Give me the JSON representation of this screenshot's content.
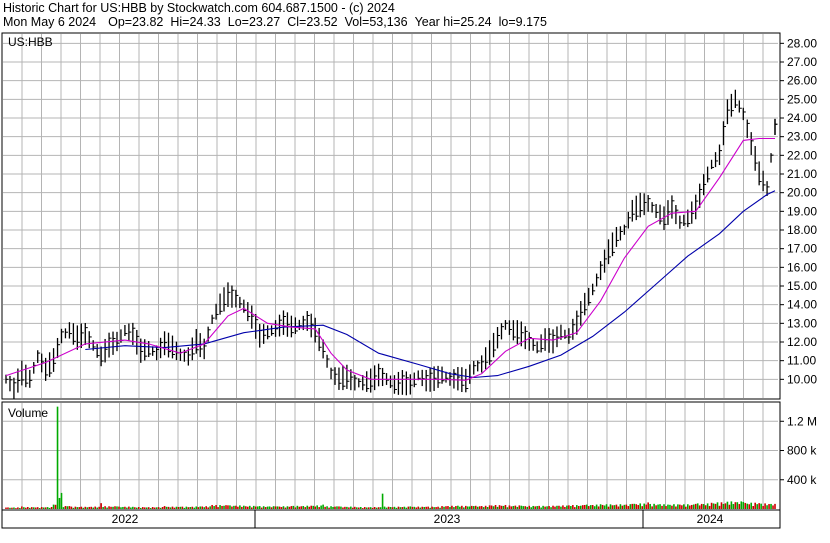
{
  "header": {
    "title": "Historic Chart for US:HBB by Stockwatch.com 604.687.1500 - (c) 2024",
    "date": "Mon May  6 2024",
    "op": "Op=23.82",
    "hi": "Hi=24.33",
    "lo": "Lo=23.27",
    "cl": "Cl=23.52",
    "vol": "Vol=53,136",
    "year_hi": "Year hi=25.24",
    "year_lo": "lo=9.175"
  },
  "colors": {
    "price_bars": "#000000",
    "ma_short": "#cc00cc",
    "ma_long": "#0000aa",
    "volume_up": "#00aa00",
    "volume_down": "#cc0000",
    "grid": "#b4b4b4"
  },
  "chart_data": [
    {
      "type": "line",
      "title": "US:HBB",
      "price_ylim": [
        9.0,
        28.5
      ],
      "y_ticks": [
        "28.00",
        "27.00",
        "26.00",
        "25.00",
        "24.00",
        "23.00",
        "22.00",
        "21.00",
        "20.00",
        "19.00",
        "18.00",
        "17.00",
        "16.00",
        "15.00",
        "14.00",
        "13.00",
        "12.00",
        "11.00",
        "10.00"
      ],
      "x_labels": [
        "2022",
        "2023",
        "2024"
      ],
      "grid": true,
      "price_series": [
        {
          "x": 0,
          "y": 10.0
        },
        {
          "x": 2,
          "y": 9.5
        },
        {
          "x": 4,
          "y": 10.3
        },
        {
          "x": 6,
          "y": 10.0
        },
        {
          "x": 8,
          "y": 11.2
        },
        {
          "x": 10,
          "y": 10.5
        },
        {
          "x": 12,
          "y": 11.0
        },
        {
          "x": 14,
          "y": 12.3
        },
        {
          "x": 16,
          "y": 12.6
        },
        {
          "x": 18,
          "y": 12.2
        },
        {
          "x": 20,
          "y": 12.4
        },
        {
          "x": 22,
          "y": 11.8
        },
        {
          "x": 24,
          "y": 11.2
        },
        {
          "x": 26,
          "y": 11.8
        },
        {
          "x": 28,
          "y": 12.0
        },
        {
          "x": 30,
          "y": 12.6
        },
        {
          "x": 32,
          "y": 12.4
        },
        {
          "x": 34,
          "y": 11.5
        },
        {
          "x": 36,
          "y": 11.6
        },
        {
          "x": 38,
          "y": 11.4
        },
        {
          "x": 40,
          "y": 11.9
        },
        {
          "x": 42,
          "y": 11.7
        },
        {
          "x": 44,
          "y": 11.3
        },
        {
          "x": 46,
          "y": 11.2
        },
        {
          "x": 48,
          "y": 12.0
        },
        {
          "x": 50,
          "y": 11.6
        },
        {
          "x": 52,
          "y": 13.2
        },
        {
          "x": 54,
          "y": 14.0
        },
        {
          "x": 56,
          "y": 14.5
        },
        {
          "x": 58,
          "y": 14.3
        },
        {
          "x": 60,
          "y": 13.9
        },
        {
          "x": 62,
          "y": 13.3
        },
        {
          "x": 64,
          "y": 12.3
        },
        {
          "x": 66,
          "y": 12.5
        },
        {
          "x": 68,
          "y": 12.7
        },
        {
          "x": 70,
          "y": 13.0
        },
        {
          "x": 72,
          "y": 12.8
        },
        {
          "x": 74,
          "y": 12.9
        },
        {
          "x": 76,
          "y": 13.1
        },
        {
          "x": 78,
          "y": 12.6
        },
        {
          "x": 80,
          "y": 11.6
        },
        {
          "x": 82,
          "y": 10.3
        },
        {
          "x": 84,
          "y": 10.0
        },
        {
          "x": 86,
          "y": 10.1
        },
        {
          "x": 88,
          "y": 9.8
        },
        {
          "x": 90,
          "y": 9.8
        },
        {
          "x": 92,
          "y": 9.9
        },
        {
          "x": 94,
          "y": 10.2
        },
        {
          "x": 96,
          "y": 10.0
        },
        {
          "x": 98,
          "y": 9.7
        },
        {
          "x": 100,
          "y": 9.8
        },
        {
          "x": 102,
          "y": 9.7
        },
        {
          "x": 104,
          "y": 10.2
        },
        {
          "x": 106,
          "y": 9.9
        },
        {
          "x": 108,
          "y": 10.0
        },
        {
          "x": 110,
          "y": 10.2
        },
        {
          "x": 112,
          "y": 10.0
        },
        {
          "x": 114,
          "y": 10.0
        },
        {
          "x": 116,
          "y": 9.9
        },
        {
          "x": 118,
          "y": 10.6
        },
        {
          "x": 120,
          "y": 10.8
        },
        {
          "x": 122,
          "y": 11.4
        },
        {
          "x": 124,
          "y": 12.2
        },
        {
          "x": 126,
          "y": 12.9
        },
        {
          "x": 128,
          "y": 12.6
        },
        {
          "x": 130,
          "y": 12.4
        },
        {
          "x": 132,
          "y": 12.0
        },
        {
          "x": 134,
          "y": 11.7
        },
        {
          "x": 136,
          "y": 12.1
        },
        {
          "x": 138,
          "y": 12.0
        },
        {
          "x": 140,
          "y": 12.5
        },
        {
          "x": 142,
          "y": 12.3
        },
        {
          "x": 144,
          "y": 13.0
        },
        {
          "x": 146,
          "y": 14.0
        },
        {
          "x": 148,
          "y": 14.8
        },
        {
          "x": 150,
          "y": 15.8
        },
        {
          "x": 152,
          "y": 16.8
        },
        {
          "x": 154,
          "y": 17.6
        },
        {
          "x": 156,
          "y": 18.0
        },
        {
          "x": 158,
          "y": 19.0
        },
        {
          "x": 160,
          "y": 19.3
        },
        {
          "x": 162,
          "y": 19.4
        },
        {
          "x": 164,
          "y": 19.0
        },
        {
          "x": 166,
          "y": 18.6
        },
        {
          "x": 168,
          "y": 19.2
        },
        {
          "x": 170,
          "y": 18.4
        },
        {
          "x": 172,
          "y": 18.6
        },
        {
          "x": 174,
          "y": 19.2
        },
        {
          "x": 176,
          "y": 20.4
        },
        {
          "x": 178,
          "y": 21.5
        },
        {
          "x": 180,
          "y": 22.0
        },
        {
          "x": 182,
          "y": 24.3
        },
        {
          "x": 184,
          "y": 25.0
        },
        {
          "x": 186,
          "y": 24.2
        },
        {
          "x": 188,
          "y": 22.6
        },
        {
          "x": 190,
          "y": 21.0
        },
        {
          "x": 192,
          "y": 20.2
        },
        {
          "x": 194,
          "y": 23.5
        }
      ],
      "ma_short": [
        {
          "x": 0,
          "y": 10.2
        },
        {
          "x": 10,
          "y": 10.9
        },
        {
          "x": 20,
          "y": 11.9
        },
        {
          "x": 30,
          "y": 12.1
        },
        {
          "x": 36,
          "y": 11.9
        },
        {
          "x": 44,
          "y": 11.4
        },
        {
          "x": 50,
          "y": 11.9
        },
        {
          "x": 56,
          "y": 13.4
        },
        {
          "x": 60,
          "y": 13.8
        },
        {
          "x": 66,
          "y": 13.0
        },
        {
          "x": 72,
          "y": 12.8
        },
        {
          "x": 78,
          "y": 12.7
        },
        {
          "x": 82,
          "y": 11.4
        },
        {
          "x": 86,
          "y": 10.5
        },
        {
          "x": 92,
          "y": 10.0
        },
        {
          "x": 100,
          "y": 10.0
        },
        {
          "x": 110,
          "y": 10.0
        },
        {
          "x": 116,
          "y": 9.95
        },
        {
          "x": 120,
          "y": 10.3
        },
        {
          "x": 126,
          "y": 11.5
        },
        {
          "x": 132,
          "y": 12.2
        },
        {
          "x": 138,
          "y": 12.1
        },
        {
          "x": 144,
          "y": 12.5
        },
        {
          "x": 150,
          "y": 14.2
        },
        {
          "x": 156,
          "y": 16.5
        },
        {
          "x": 162,
          "y": 18.2
        },
        {
          "x": 168,
          "y": 18.9
        },
        {
          "x": 174,
          "y": 19.0
        },
        {
          "x": 180,
          "y": 20.8
        },
        {
          "x": 186,
          "y": 22.8
        },
        {
          "x": 190,
          "y": 22.9
        },
        {
          "x": 194,
          "y": 22.9
        }
      ],
      "ma_long": [
        {
          "x": 20,
          "y": 11.6
        },
        {
          "x": 30,
          "y": 11.8
        },
        {
          "x": 40,
          "y": 11.7
        },
        {
          "x": 50,
          "y": 11.9
        },
        {
          "x": 60,
          "y": 12.5
        },
        {
          "x": 70,
          "y": 12.8
        },
        {
          "x": 80,
          "y": 12.9
        },
        {
          "x": 86,
          "y": 12.4
        },
        {
          "x": 94,
          "y": 11.4
        },
        {
          "x": 104,
          "y": 10.8
        },
        {
          "x": 112,
          "y": 10.3
        },
        {
          "x": 118,
          "y": 10.1
        },
        {
          "x": 124,
          "y": 10.2
        },
        {
          "x": 132,
          "y": 10.7
        },
        {
          "x": 140,
          "y": 11.3
        },
        {
          "x": 148,
          "y": 12.3
        },
        {
          "x": 156,
          "y": 13.6
        },
        {
          "x": 164,
          "y": 15.1
        },
        {
          "x": 172,
          "y": 16.6
        },
        {
          "x": 180,
          "y": 17.8
        },
        {
          "x": 186,
          "y": 19.0
        },
        {
          "x": 192,
          "y": 19.9
        },
        {
          "x": 194,
          "y": 20.1
        }
      ]
    },
    {
      "type": "bar",
      "title": "Volume",
      "y_ticks": [
        "1.2 M",
        "800 k",
        "400 k"
      ],
      "ylim": [
        0,
        1450000
      ],
      "volume_series": [
        {
          "x": 0,
          "y": 20000
        },
        {
          "x": 4,
          "y": 35000
        },
        {
          "x": 8,
          "y": 25000
        },
        {
          "x": 12,
          "y": 60000
        },
        {
          "x": 13,
          "y": 1400000
        },
        {
          "x": 14,
          "y": 220000
        },
        {
          "x": 16,
          "y": 40000
        },
        {
          "x": 20,
          "y": 30000
        },
        {
          "x": 24,
          "y": 80000
        },
        {
          "x": 28,
          "y": 35000
        },
        {
          "x": 32,
          "y": 30000
        },
        {
          "x": 36,
          "y": 25000
        },
        {
          "x": 40,
          "y": 40000
        },
        {
          "x": 44,
          "y": 30000
        },
        {
          "x": 48,
          "y": 35000
        },
        {
          "x": 52,
          "y": 55000
        },
        {
          "x": 56,
          "y": 50000
        },
        {
          "x": 60,
          "y": 45000
        },
        {
          "x": 64,
          "y": 40000
        },
        {
          "x": 68,
          "y": 35000
        },
        {
          "x": 72,
          "y": 40000
        },
        {
          "x": 76,
          "y": 45000
        },
        {
          "x": 80,
          "y": 60000
        },
        {
          "x": 84,
          "y": 35000
        },
        {
          "x": 88,
          "y": 30000
        },
        {
          "x": 92,
          "y": 25000
        },
        {
          "x": 95,
          "y": 210000
        },
        {
          "x": 98,
          "y": 30000
        },
        {
          "x": 102,
          "y": 35000
        },
        {
          "x": 106,
          "y": 30000
        },
        {
          "x": 110,
          "y": 40000
        },
        {
          "x": 114,
          "y": 45000
        },
        {
          "x": 118,
          "y": 40000
        },
        {
          "x": 122,
          "y": 50000
        },
        {
          "x": 126,
          "y": 55000
        },
        {
          "x": 130,
          "y": 45000
        },
        {
          "x": 134,
          "y": 40000
        },
        {
          "x": 138,
          "y": 45000
        },
        {
          "x": 142,
          "y": 50000
        },
        {
          "x": 146,
          "y": 55000
        },
        {
          "x": 150,
          "y": 65000
        },
        {
          "x": 154,
          "y": 60000
        },
        {
          "x": 158,
          "y": 70000
        },
        {
          "x": 162,
          "y": 90000
        },
        {
          "x": 166,
          "y": 65000
        },
        {
          "x": 170,
          "y": 60000
        },
        {
          "x": 174,
          "y": 70000
        },
        {
          "x": 178,
          "y": 85000
        },
        {
          "x": 182,
          "y": 100000
        },
        {
          "x": 186,
          "y": 95000
        },
        {
          "x": 190,
          "y": 80000
        },
        {
          "x": 194,
          "y": 70000
        }
      ]
    }
  ]
}
